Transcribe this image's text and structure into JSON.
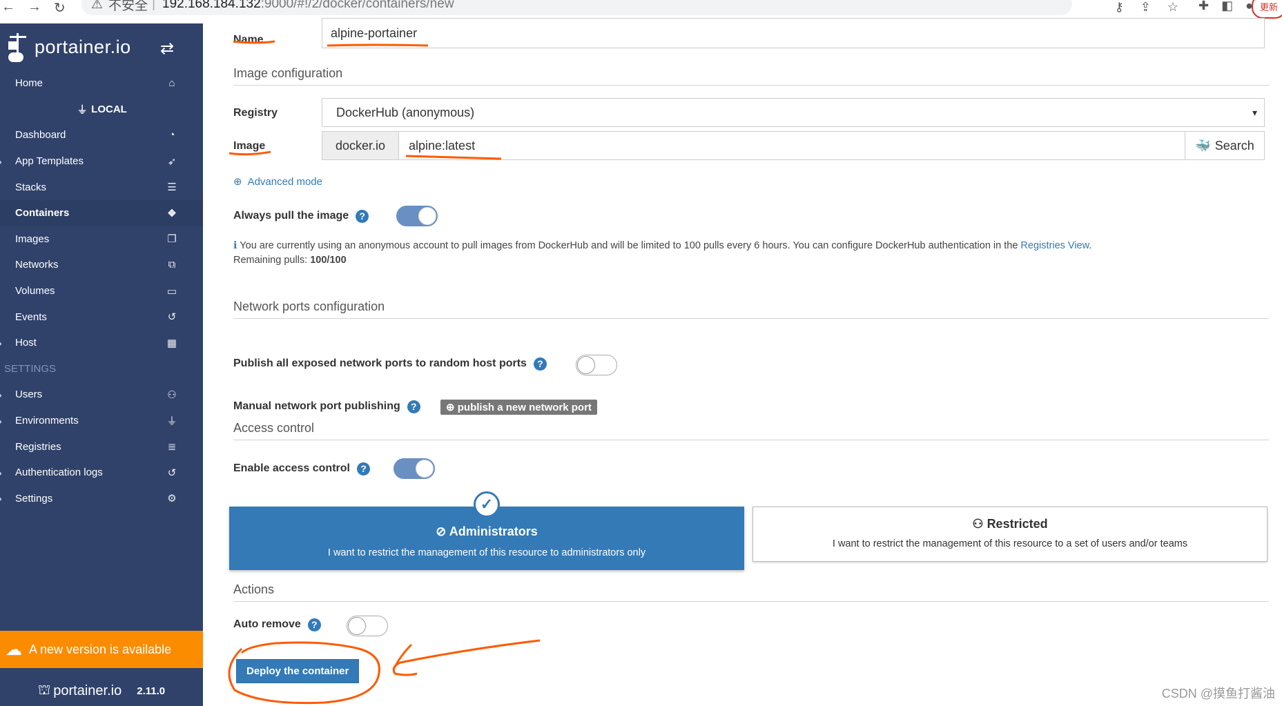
{
  "browser": {
    "insecure_label": "不安全",
    "url_host": "192.168.184.132",
    "url_path": ":9000/#!/2/docker/containers/new",
    "update_label": "更新"
  },
  "sidebar": {
    "brand": "portainer.io",
    "items": [
      {
        "label": "Home",
        "icon": "home-icon",
        "glyph": "⌂"
      },
      {
        "label": "LOCAL",
        "icon": "plug-icon",
        "glyph": "⏚"
      },
      {
        "label": "Dashboard",
        "icon": "dashboard-icon",
        "glyph": "◔"
      },
      {
        "label": "App Templates",
        "icon": "rocket-icon",
        "glyph": "➶"
      },
      {
        "label": "Stacks",
        "icon": "th-list-icon",
        "glyph": "☰"
      },
      {
        "label": "Containers",
        "icon": "cubes-icon",
        "glyph": "❖"
      },
      {
        "label": "Images",
        "icon": "clone-icon",
        "glyph": "❐"
      },
      {
        "label": "Networks",
        "icon": "sitemap-icon",
        "glyph": "⧉"
      },
      {
        "label": "Volumes",
        "icon": "hdd-icon",
        "glyph": "▭"
      },
      {
        "label": "Events",
        "icon": "history-icon",
        "glyph": "↺"
      },
      {
        "label": "Host",
        "icon": "th-icon",
        "glyph": "▦"
      },
      {
        "label": "SETTINGS"
      },
      {
        "label": "Users",
        "icon": "users-icon",
        "glyph": "⚇"
      },
      {
        "label": "Environments",
        "icon": "plug-icon",
        "glyph": "⏚"
      },
      {
        "label": "Registries",
        "icon": "database-icon",
        "glyph": "≣"
      },
      {
        "label": "Authentication logs",
        "icon": "history-icon",
        "glyph": "↺"
      },
      {
        "label": "Settings",
        "icon": "cogs-icon",
        "glyph": "⚙"
      }
    ],
    "new_version": "A new version is available",
    "footer_brand": "portainer.io",
    "footer_version": "2.11.0"
  },
  "form": {
    "name_label": "Name",
    "name_value": "alpine-portainer",
    "image_config_title": "Image configuration",
    "registry_label": "Registry",
    "registry_value": "DockerHub (anonymous)",
    "image_label": "Image",
    "image_prefix": "docker.io",
    "image_value": "alpine:latest",
    "search_label": "Search",
    "advanced_mode": "Advanced mode",
    "always_pull_label": "Always pull the image",
    "always_pull_on": true,
    "anon_note": "You are currently using an anonymous account to pull images from DockerHub and will be limited to 100 pulls every 6 hours. You can configure DockerHub authentication in the",
    "registries_view_link": "Registries View",
    "remaining_label": "Remaining pulls:",
    "remaining_value": "100/100",
    "ports_title": "Network ports configuration",
    "publish_all_label": "Publish all exposed network ports to random host ports",
    "manual_publish_label": "Manual network port publishing",
    "publish_new_button": "publish a new network port",
    "access_title": "Access control",
    "enable_access_label": "Enable access control",
    "admin_title": "Administrators",
    "admin_desc": "I want to restrict the management of this resource to administrators only",
    "restricted_title": "Restricted",
    "restricted_desc": "I want to restrict the management of this resource to a set of users and/or teams",
    "actions_title": "Actions",
    "auto_remove_label": "Auto remove",
    "deploy_button": "Deploy the container"
  },
  "watermark": "CSDN @摸鱼打酱油",
  "colors": {
    "sidebar": "#30426a",
    "accent": "#337ab7",
    "new_version": "#fb8c00",
    "annotation": "#ff5a00"
  }
}
